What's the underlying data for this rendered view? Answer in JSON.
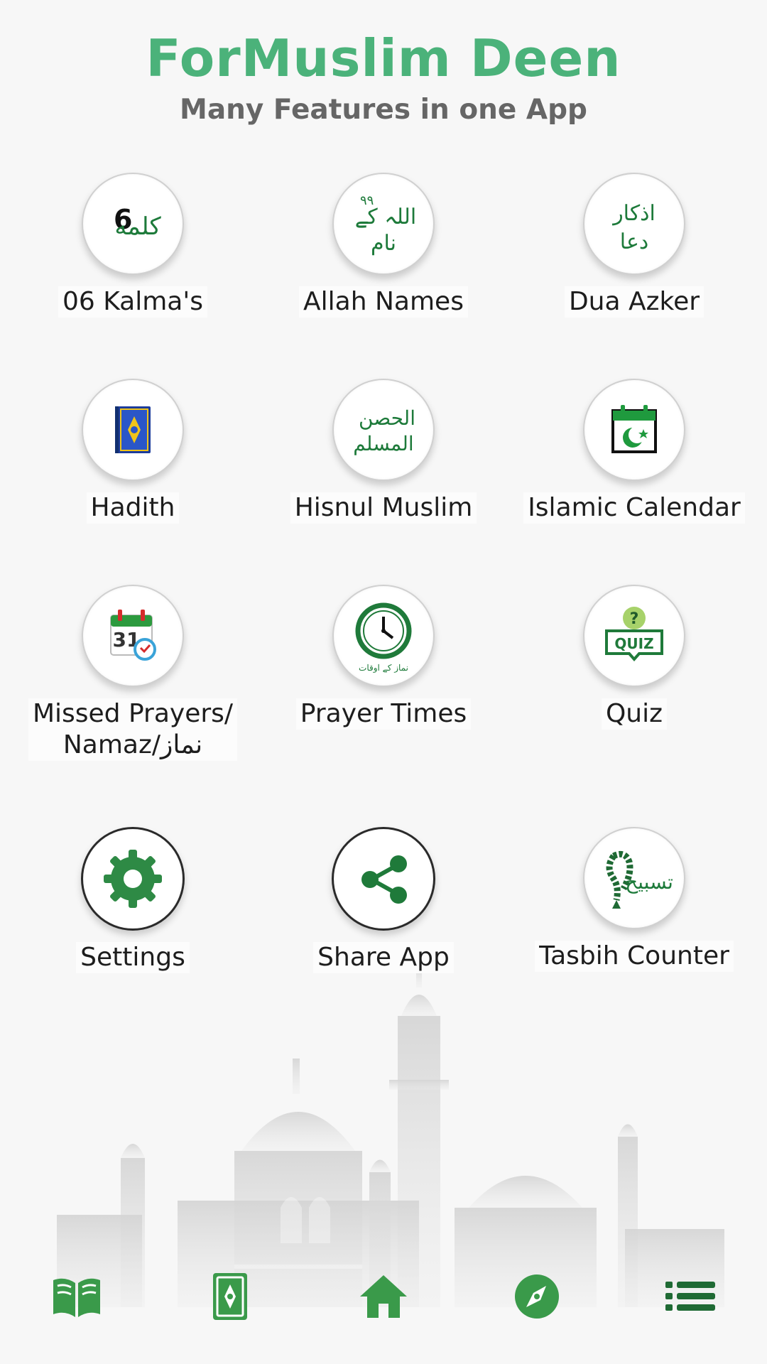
{
  "header": {
    "title": "ForMuslim Deen",
    "subtitle": "Many Features in one App"
  },
  "features": [
    {
      "label": "06 Kalma's",
      "icon": "kalma-icon"
    },
    {
      "label": "Allah Names",
      "icon": "allah-names-icon"
    },
    {
      "label": "Dua Azker",
      "icon": "dua-azkar-icon"
    },
    {
      "label": "Hadith",
      "icon": "hadith-book-icon"
    },
    {
      "label": "Hisnul Muslim",
      "icon": "hisnul-muslim-icon"
    },
    {
      "label": "Islamic Calendar",
      "icon": "calendar-crescent-icon"
    },
    {
      "label": "Missed Prayers/",
      "label2": "Namaz/نماز",
      "icon": "calendar-31-icon"
    },
    {
      "label": "Prayer Times",
      "icon": "clock-icon"
    },
    {
      "label": "Quiz",
      "icon": "quiz-icon"
    },
    {
      "label": "Settings",
      "icon": "gear-icon"
    },
    {
      "label": "Share App",
      "icon": "share-icon"
    },
    {
      "label": "Tasbih Counter",
      "icon": "tasbih-beads-icon"
    }
  ],
  "icon_text": {
    "kalma_number": "6",
    "kalma_arabic": "كلمه",
    "allah_number": "۹۹",
    "allah_arabic": "اللہ کے",
    "allah_arabic2": "نام",
    "dua_arabic": "اذکار",
    "dua_arabic2": "دعا",
    "hisnul_arabic": "الحصن",
    "hisnul_arabic2": "المسلم",
    "calendar_day": "31",
    "prayer_arabic": "نماز کے اوقات",
    "quiz_text": "QUIZ",
    "quiz_mark": "?",
    "tasbih_arabic": "تسبیح"
  },
  "bottom_nav": [
    {
      "icon": "open-book-icon"
    },
    {
      "icon": "quran-icon"
    },
    {
      "icon": "home-icon"
    },
    {
      "icon": "compass-icon"
    },
    {
      "icon": "menu-list-icon"
    }
  ],
  "colors": {
    "title": "#4bb27a",
    "subtitle": "#666666",
    "icon_green": "#1d7a3a",
    "nav_green": "#3a9a4a"
  }
}
